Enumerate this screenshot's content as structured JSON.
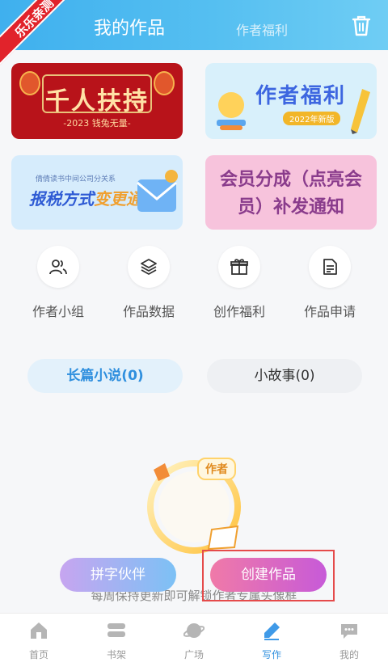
{
  "watermark": "乐乐亲测",
  "header": {
    "tab_active": "我的作品",
    "tab_other": "作者福利",
    "trash_icon": "trash-icon"
  },
  "banners": [
    {
      "title": "千人扶持",
      "subtitle": "-2023 钱兔无量-"
    },
    {
      "title": "作者福利",
      "subtitle": "2022年新版"
    },
    {
      "small": "倩倩读书中间公司分关系",
      "title_a": "报税方式",
      "title_b": "变更通知"
    },
    {
      "title_line1": "会员分成（点亮会",
      "title_line2": "员）补发通知"
    }
  ],
  "quick_actions": [
    {
      "label": "作者小组",
      "icon": "group-icon"
    },
    {
      "label": "作品数据",
      "icon": "layers-icon"
    },
    {
      "label": "创作福利",
      "icon": "gift-icon"
    },
    {
      "label": "作品申请",
      "icon": "document-icon"
    }
  ],
  "category_tabs": {
    "long_novel": "长篇小说(0)",
    "short_story": "小故事(0)"
  },
  "illustration": {
    "badge": "作者"
  },
  "hint_text": "每周保持更新即可解锁作者专属头像框",
  "buttons": {
    "partner": "拼字伙伴",
    "create": "创建作品"
  },
  "bottom_nav": [
    {
      "label": "首页",
      "icon": "home-icon"
    },
    {
      "label": "书架",
      "icon": "bookshelf-icon"
    },
    {
      "label": "广场",
      "icon": "planet-icon"
    },
    {
      "label": "写作",
      "icon": "pen-icon"
    },
    {
      "label": "我的",
      "icon": "chat-icon"
    }
  ],
  "colors": {
    "header": "#3fb0ee",
    "accent": "#2f8fde",
    "create_button": "#e46ab0",
    "highlight": "#e54b4b"
  }
}
